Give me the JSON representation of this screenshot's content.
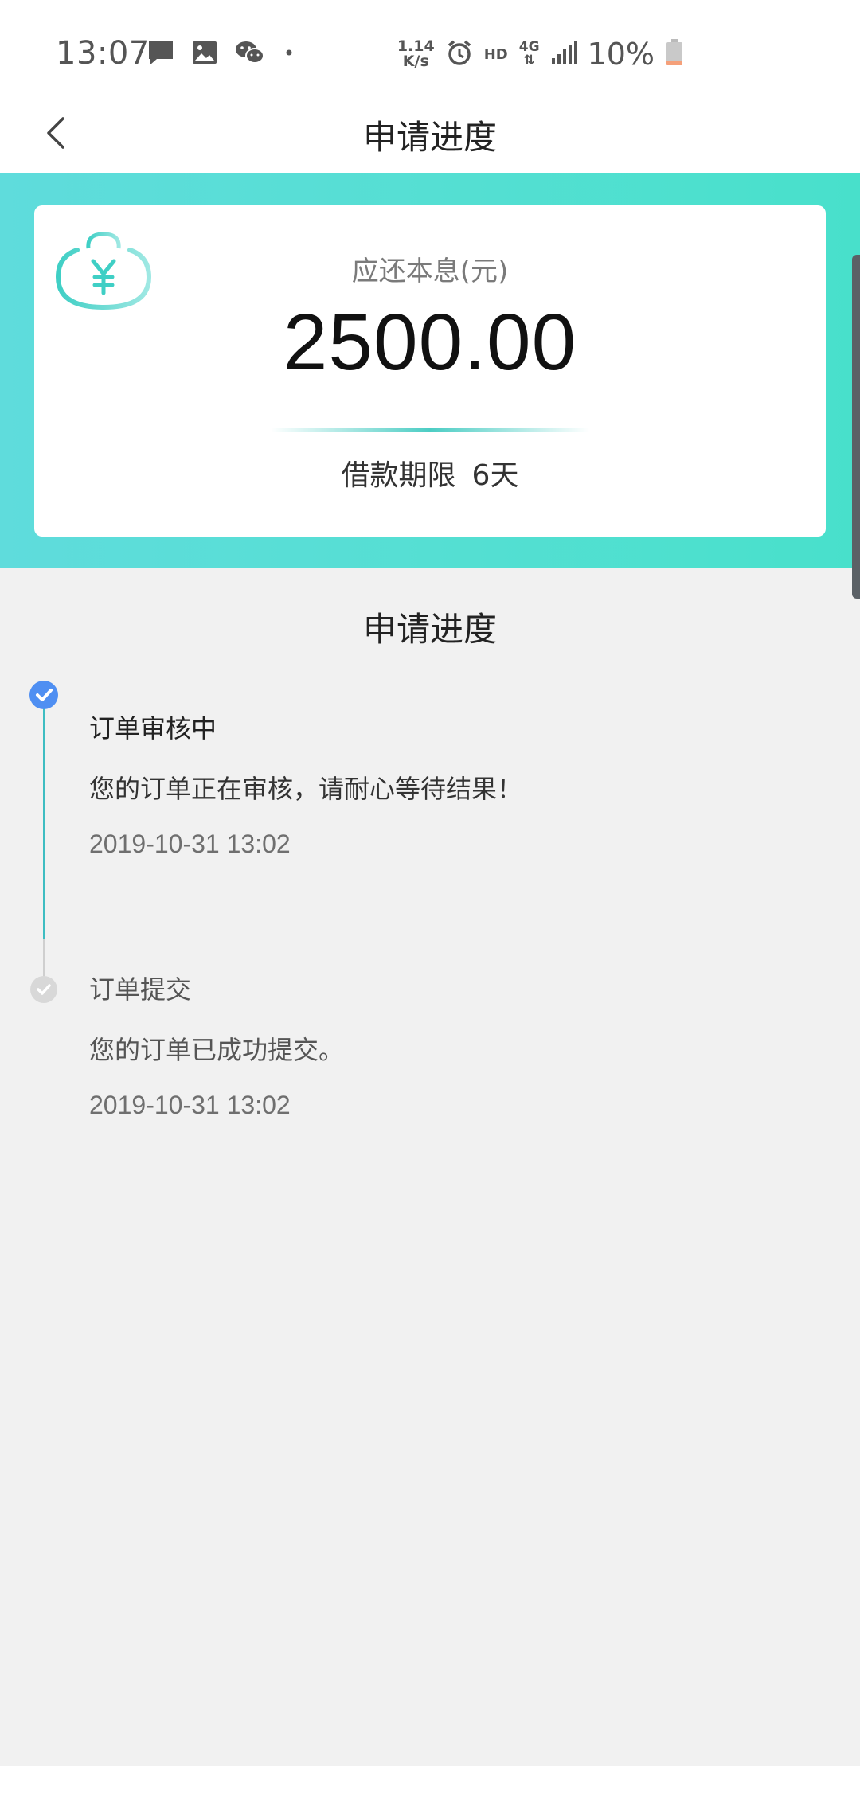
{
  "status_bar": {
    "time": "13:07",
    "left_icons": [
      "message-icon",
      "image-icon",
      "wechat-icon",
      "dot-icon"
    ],
    "net_speed_value": "1.14",
    "net_speed_unit": "K/s",
    "hd": "HD",
    "network": "4G",
    "battery": "10%",
    "battery_color": "#f5a07a"
  },
  "header": {
    "title": "申请进度",
    "back_icon": "chevron-left-icon"
  },
  "summary": {
    "amount_label": "应还本息(元)",
    "amount_value": "2500.00",
    "term_label": "借款期限",
    "term_value": "6天",
    "icon": "money-bag-icon",
    "accent_color": "#4ccdc4"
  },
  "progress": {
    "title": "申请进度",
    "steps": [
      {
        "title": "订单审核中",
        "desc": "您的订单正在审核，请耐心等待结果！",
        "time": "2019-10-31 13:02",
        "status": "active",
        "dot_color": "#4f8ff2"
      },
      {
        "title": "订单提交",
        "desc": "您的订单已成功提交。",
        "time": "2019-10-31 13:02",
        "status": "done",
        "dot_color": "#d8d8d8"
      }
    ]
  }
}
